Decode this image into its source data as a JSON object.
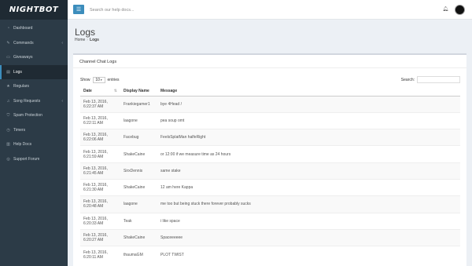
{
  "app": {
    "logo": "NIGHTBOT"
  },
  "topbar": {
    "search_placeholder": "Search our help docs..."
  },
  "sidebar": {
    "items": [
      {
        "label": "Dashboard",
        "icon": "dashboard-icon",
        "glyph": "◔",
        "active": false,
        "chevron": ""
      },
      {
        "label": "Commands",
        "icon": "pencil-icon",
        "glyph": "✎",
        "active": false,
        "chevron": "‹"
      },
      {
        "label": "Giveaways",
        "icon": "gift-icon",
        "glyph": "▭",
        "active": false,
        "chevron": ""
      },
      {
        "label": "Logs",
        "icon": "document-icon",
        "glyph": "▤",
        "active": true,
        "chevron": ""
      },
      {
        "label": "Regulars",
        "icon": "star-icon",
        "glyph": "★",
        "active": false,
        "chevron": ""
      },
      {
        "label": "Song Requests",
        "icon": "music-icon",
        "glyph": "♫",
        "active": false,
        "chevron": "‹"
      },
      {
        "label": "Spam Protection",
        "icon": "shield-icon",
        "glyph": "⛉",
        "active": false,
        "chevron": ""
      },
      {
        "label": "Timers",
        "icon": "clock-icon",
        "glyph": "◷",
        "active": false,
        "chevron": ""
      },
      {
        "label": "Help Docs",
        "icon": "book-icon",
        "glyph": "▥",
        "active": false,
        "chevron": ""
      },
      {
        "label": "Support Forum",
        "icon": "globe-icon",
        "glyph": "◎",
        "active": false,
        "chevron": ""
      }
    ]
  },
  "page": {
    "title": "Logs",
    "breadcrumb": [
      "Home",
      "Logs"
    ],
    "separator": "›"
  },
  "box": {
    "title": "Channel Chat Logs",
    "show_label": "Show",
    "entries_value": "10",
    "entries_label": "entries",
    "search_label": "Search:"
  },
  "table": {
    "headers": [
      "Date",
      "Display Name",
      "Message"
    ],
    "rows": [
      {
        "date1": "Feb 13, 2016,",
        "date2": "6:22:37 AM",
        "name": "Frankiegamer1",
        "message": "bye 4Head /"
      },
      {
        "date1": "Feb 13, 2016,",
        "date2": "6:22:11 AM",
        "name": "laagone",
        "message": "pea soup omt"
      },
      {
        "date1": "Feb 13, 2016,",
        "date2": "6:22:06 AM",
        "name": "Facebug",
        "message": "FeelsSplatMan halfeRight"
      },
      {
        "date1": "Feb 13, 2016,",
        "date2": "6:21:59 AM",
        "name": "ShakeCaine",
        "message": "or 12:00 if we measure time as 24 hours"
      },
      {
        "date1": "Feb 13, 2016,",
        "date2": "6:21:45 AM",
        "name": "SirxDennis",
        "message": "same stake"
      },
      {
        "date1": "Feb 13, 2016,",
        "date2": "6:21:30 AM",
        "name": "ShakeCaine",
        "message": "12 am here Kappa"
      },
      {
        "date1": "Feb 13, 2016,",
        "date2": "6:20:48 AM",
        "name": "laagone",
        "message": "me too but being stuck there forever probably sucks"
      },
      {
        "date1": "Feb 13, 2016,",
        "date2": "6:20:33 AM",
        "name": "Teak",
        "message": "i like space"
      },
      {
        "date1": "Feb 13, 2016,",
        "date2": "6:20:27 AM",
        "name": "ShakeCaine",
        "message": "Spaceeeeee"
      },
      {
        "date1": "Feb 13, 2016,",
        "date2": "6:20:11 AM",
        "name": "thaumaGM",
        "message": "PLOT TWIST"
      }
    ]
  },
  "colors": {
    "sidebar": "#2c3b47",
    "accent": "#3c8dbc",
    "background": "#ecf0f5"
  }
}
